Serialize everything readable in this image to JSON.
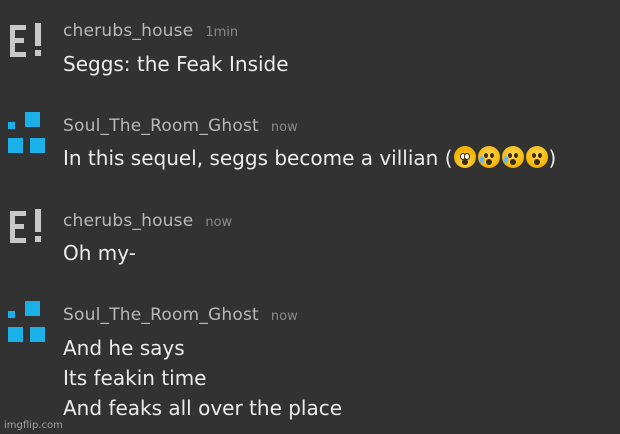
{
  "messages": [
    {
      "username": "cherubs_house",
      "time": "1min",
      "avatar": "e-exclaim-logo",
      "lines": [
        "Seggs: the Feak Inside"
      ]
    },
    {
      "username": "Soul_The_Room_Ghost",
      "time": "now",
      "avatar": "blue-squares-logo",
      "lines": [
        "In this sequel, seggs become a villian ("
      ],
      "line_end": ")",
      "emojis": [
        "face-screaming-in-fear",
        "anxious-face-with-sweat",
        "anxious-face-with-sweat",
        "fearful-face"
      ]
    },
    {
      "username": "cherubs_house",
      "time": "now",
      "avatar": "e-exclaim-logo",
      "lines": [
        "Oh my-"
      ]
    },
    {
      "username": "Soul_The_Room_Ghost",
      "time": "now",
      "avatar": "blue-squares-logo",
      "lines": [
        "And he says",
        "Its feakin time",
        "And feaks all over the place"
      ]
    }
  ],
  "watermark": "imgflip.com",
  "colors": {
    "background": "#323232",
    "username": "#b9b9b9",
    "text": "#ececec",
    "accent": "#1ab0e8"
  }
}
